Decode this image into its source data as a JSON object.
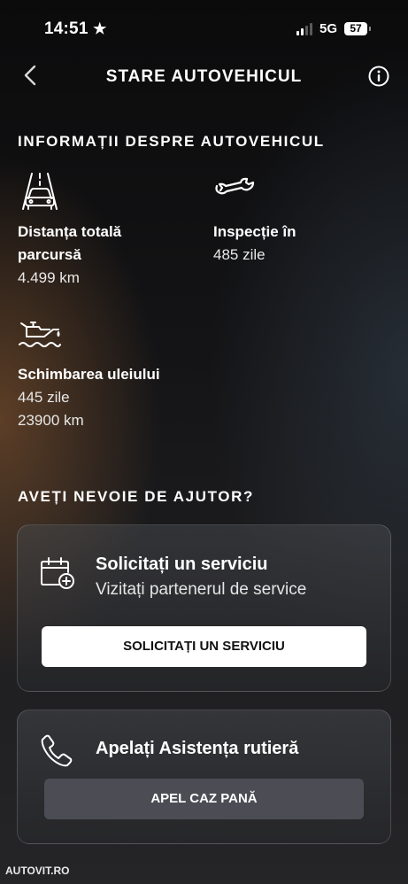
{
  "status_bar": {
    "time": "14:51",
    "network": "5G",
    "battery": "57"
  },
  "header": {
    "title": "STARE AUTOVEHICUL"
  },
  "vehicle_info": {
    "section_title": "INFORMAȚII DESPRE AUTOVEHICUL",
    "distance": {
      "label_line1": "Distanța totală",
      "label_line2": "parcursă",
      "value": "4.499 km",
      "icon": "car-road-icon"
    },
    "inspection": {
      "label": "Inspecție în",
      "value": "485 zile",
      "icon": "wrench-icon"
    },
    "oil": {
      "label": "Schimbarea uleiului",
      "value_days": "445 zile",
      "value_km": "23900 km",
      "icon": "oil-can-icon"
    }
  },
  "help": {
    "section_title": "AVEȚI NEVOIE DE AJUTOR?",
    "service_card": {
      "title": "Solicitați un serviciu",
      "subtitle": "Vizitați partenerul de service",
      "button": "SOLICITAȚI UN SERVICIU",
      "icon": "calendar-add-icon"
    },
    "roadside_card": {
      "title": "Apelați Asistența rutieră",
      "button": "APEL CAZ PANĂ",
      "icon": "phone-icon"
    }
  },
  "watermark": "AUTOVIT.RO",
  "colors": {
    "background": "#141416",
    "button_primary": "#ffffff",
    "button_secondary": "#4c4c55"
  }
}
